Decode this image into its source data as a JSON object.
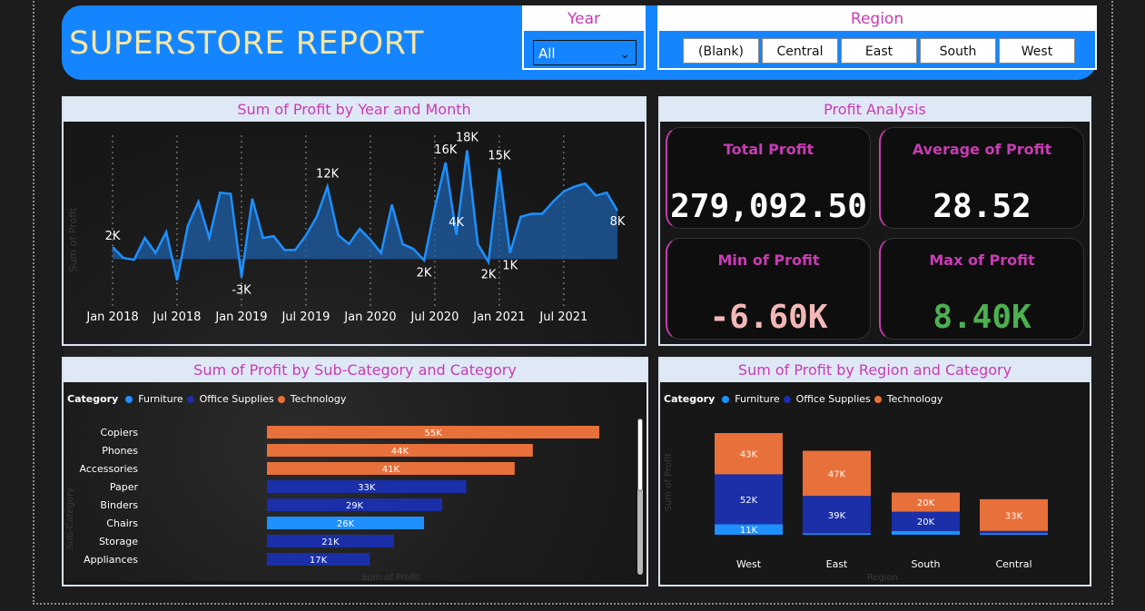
{
  "header": {
    "title": "SUPERSTORE REPORT",
    "year_slicer": {
      "label": "Year",
      "value": "All"
    },
    "region_slicer": {
      "label": "Region",
      "options": [
        "(Blank)",
        "Central",
        "East",
        "South",
        "West"
      ]
    }
  },
  "profit_trend": {
    "title": "Sum of Profit by Year and Month",
    "ylabel": "Sum of Profit"
  },
  "profit_analysis": {
    "title": "Profit Analysis",
    "total": {
      "label": "Total Profit",
      "value": "279,092.50"
    },
    "average": {
      "label": "Average of Profit",
      "value": "28.52"
    },
    "min": {
      "label": "Min of Profit",
      "value": "-6.60K"
    },
    "max": {
      "label": "Max of Profit",
      "value": "8.40K"
    }
  },
  "subcat": {
    "title": "Sum of Profit by Sub-Category and Category",
    "legend_title": "Category",
    "xlabel": "Sum of Profit",
    "ylabel": "Sub-Category"
  },
  "region": {
    "title": "Sum of Profit by Region and Category",
    "legend_title": "Category",
    "xlabel": "Region",
    "ylabel": "Sum of Profit"
  },
  "colors": {
    "Furniture": "#1e90ff",
    "Office Supplies": "#1a2fa8",
    "Technology": "#e8703a",
    "accent": "#c93bb4",
    "header": "#1585ff",
    "min_value": "#f2b7b7",
    "max_value": "#4caf50"
  },
  "chart_data": [
    {
      "type": "area",
      "title": "Sum of Profit by Year and Month",
      "ylabel": "Sum of Profit",
      "x_ticks": [
        "Jan 2018",
        "Jul 2018",
        "Jan 2019",
        "Jul 2019",
        "Jan 2020",
        "Jul 2020",
        "Jan 2021",
        "Jul 2021"
      ],
      "x": [
        "2018-01",
        "2018-02",
        "2018-03",
        "2018-04",
        "2018-05",
        "2018-06",
        "2018-07",
        "2018-08",
        "2018-09",
        "2018-10",
        "2018-11",
        "2018-12",
        "2019-01",
        "2019-02",
        "2019-03",
        "2019-04",
        "2019-05",
        "2019-06",
        "2019-07",
        "2019-08",
        "2019-09",
        "2019-10",
        "2019-11",
        "2019-12",
        "2020-01",
        "2020-02",
        "2020-03",
        "2020-04",
        "2020-05",
        "2020-06",
        "2020-07",
        "2020-08",
        "2020-09",
        "2020-10",
        "2020-11",
        "2020-12",
        "2021-01",
        "2021-02",
        "2021-03",
        "2021-04",
        "2021-05",
        "2021-06",
        "2021-07",
        "2021-08",
        "2021-09",
        "2021-10",
        "2021-11",
        "2021-12"
      ],
      "values": [
        2000,
        200,
        -100,
        3500,
        1000,
        4500,
        -3500,
        5500,
        9500,
        3500,
        11000,
        10800,
        -3000,
        10000,
        3500,
        3800,
        1500,
        1500,
        3900,
        7000,
        12000,
        4000,
        2500,
        5000,
        3200,
        1000,
        9000,
        2500,
        1700,
        -200,
        8500,
        16000,
        4000,
        18000,
        2500,
        -500,
        15000,
        1000,
        7000,
        7500,
        7500,
        9500,
        11200,
        12000,
        12500,
        10500,
        11000,
        8000
      ],
      "point_labels": [
        {
          "index": 0,
          "text": "2K"
        },
        {
          "index": 12,
          "text": "-3K"
        },
        {
          "index": 20,
          "text": "12K"
        },
        {
          "index": 29,
          "text": "2K"
        },
        {
          "index": 31,
          "text": "16K"
        },
        {
          "index": 32,
          "text": "4K"
        },
        {
          "index": 33,
          "text": "18K"
        },
        {
          "index": 35,
          "text": "2K"
        },
        {
          "index": 36,
          "text": "15K"
        },
        {
          "index": 37,
          "text": "1K"
        },
        {
          "index": 47,
          "text": "8K"
        }
      ]
    },
    {
      "type": "bar",
      "title": "Sum of Profit by Sub-Category and Category",
      "xlabel": "Sum of Profit",
      "ylabel": "Sub-Category",
      "legend": [
        "Furniture",
        "Office Supplies",
        "Technology"
      ],
      "legend_placement": "top-left",
      "categories": [
        "Copiers",
        "Phones",
        "Accessories",
        "Paper",
        "Binders",
        "Chairs",
        "Storage",
        "Appliances"
      ],
      "series_of": [
        "Technology",
        "Technology",
        "Technology",
        "Office Supplies",
        "Office Supplies",
        "Furniture",
        "Office Supplies",
        "Office Supplies"
      ],
      "values": [
        55000,
        44000,
        41000,
        33000,
        29000,
        26000,
        21000,
        17000
      ],
      "labels": [
        "55K",
        "44K",
        "41K",
        "33K",
        "29K",
        "26K",
        "21K",
        "17K"
      ]
    },
    {
      "type": "bar",
      "stacked": true,
      "title": "Sum of Profit by Region and Category",
      "xlabel": "Region",
      "ylabel": "Sum of Profit",
      "legend_placement": "top-left",
      "categories": [
        "West",
        "East",
        "South",
        "Central"
      ],
      "series": [
        {
          "name": "Furniture",
          "values": [
            11000,
            1500,
            4000,
            1500
          ],
          "labels": [
            "11K",
            "",
            "",
            ""
          ]
        },
        {
          "name": "Office Supplies",
          "values": [
            52000,
            39000,
            20000,
            2500
          ],
          "labels": [
            "52K",
            "39K",
            "20K",
            ""
          ]
        },
        {
          "name": "Technology",
          "values": [
            43000,
            47000,
            20000,
            33000
          ],
          "labels": [
            "43K",
            "47K",
            "20K",
            "33K"
          ]
        }
      ]
    }
  ]
}
